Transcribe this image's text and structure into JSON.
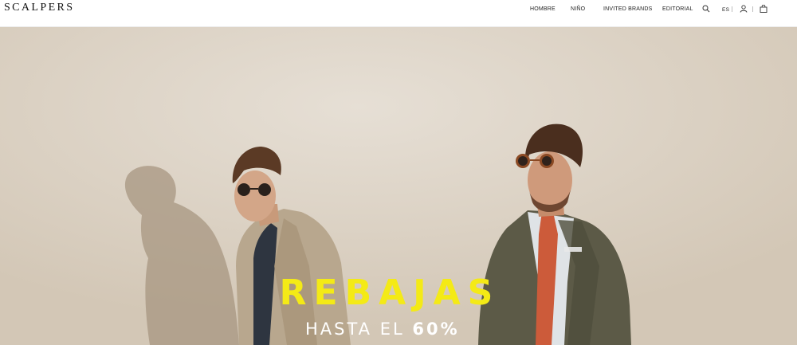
{
  "brand": {
    "logo_text": "SCALPERS"
  },
  "nav": {
    "items": [
      {
        "label": "HOMBRE"
      },
      {
        "label": "NIÑO"
      },
      {
        "label": "INVITED BRANDS"
      },
      {
        "label": "EDITORIAL"
      }
    ],
    "language": "ES",
    "icons": [
      "search-icon",
      "user-icon",
      "bag-icon"
    ]
  },
  "hero": {
    "title": "REBAJAS",
    "subtitle_prefix": "HASTA EL",
    "subtitle_highlight": "60%",
    "colors": {
      "title": "#f4ea16",
      "subtitle": "#ffffff",
      "background": "#e0d8cc"
    }
  }
}
